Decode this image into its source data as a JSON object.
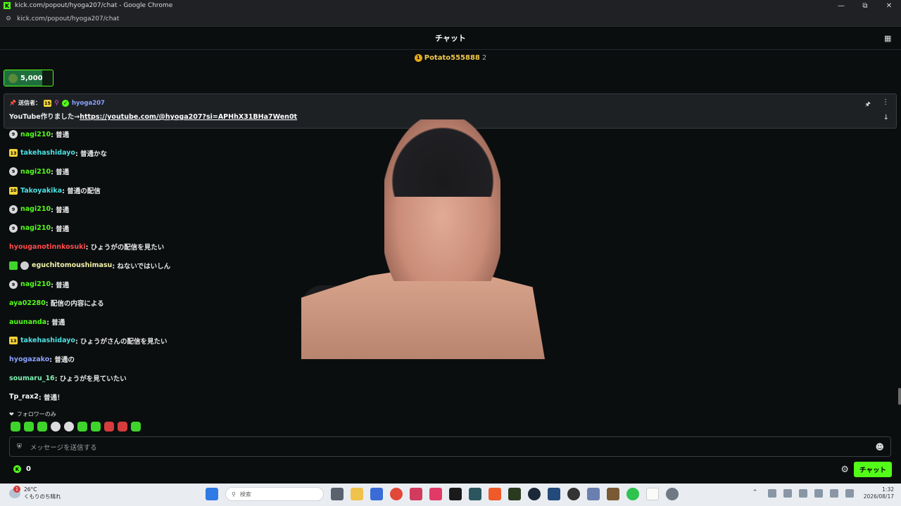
{
  "window": {
    "title": "kick.com/popout/hyoga207/chat - Google Chrome",
    "url": "kick.com/popout/hyoga207/chat",
    "logo_letter": "K"
  },
  "header": {
    "title": "チャット"
  },
  "leaderboard": {
    "rank": "1",
    "name": "Potato555888",
    "count": "2"
  },
  "points_widget": {
    "value": "5,000",
    "fill_fraction": 0.78
  },
  "pinned": {
    "sender_label": "送信者：",
    "sub_badge": "15",
    "username": "hyoga207",
    "message_prefix": "YouTube作りました→",
    "link": "https://youtube.com/@hyoga207?si=APHhX31BHa7Wen0t"
  },
  "messages": [
    {
      "badge": "9",
      "badge_type": "one",
      "user": "nagi210",
      "color": "#53fc18",
      "text": ": 普通"
    },
    {
      "badge": "13",
      "badge_type": "lvl",
      "user": "takehashidayo",
      "color": "#4ee0e0",
      "text": ": 普通かな"
    },
    {
      "badge": "9",
      "badge_type": "one",
      "user": "nagi210",
      "color": "#53fc18",
      "text": ": 普通"
    },
    {
      "badge": "10",
      "badge_type": "lvl",
      "user": "Takoyakika",
      "color": "#4ee0e0",
      "text": ": 普通の配信"
    },
    {
      "badge": "9",
      "badge_type": "one",
      "user": "nagi210",
      "color": "#53fc18",
      "text": ": 普通"
    },
    {
      "badge": "9",
      "badge_type": "one",
      "user": "nagi210",
      "color": "#53fc18",
      "text": ": 普通"
    },
    {
      "badge": "",
      "badge_type": "none",
      "user": "hyouganotinnkosuki",
      "color": "#ff4b4b",
      "text": ": ひょうがの配信を見たい"
    },
    {
      "badge": "",
      "badge_type": "emote",
      "user": "eguchitomoushimasu",
      "color": "#f2f2a8",
      "text": ": ねないではいしん"
    },
    {
      "badge": "9",
      "badge_type": "one",
      "user": "nagi210",
      "color": "#53fc18",
      "text": ": 普通"
    },
    {
      "badge": "",
      "badge_type": "none",
      "user": "aya02280",
      "color": "#53fc18",
      "text": ": 配信の内容による"
    },
    {
      "badge": "",
      "badge_type": "none",
      "user": "auunanda",
      "color": "#53fc18",
      "text": ": 普通"
    },
    {
      "badge": "13",
      "badge_type": "lvl",
      "user": "takehashidayo",
      "color": "#4ee0e0",
      "text": ": ひょうがさんの配信を見たい"
    },
    {
      "badge": "",
      "badge_type": "none",
      "user": "hyogazako",
      "color": "#8aa2ff",
      "text": ": 普通の"
    },
    {
      "badge": "",
      "badge_type": "none",
      "user": "soumaru_16",
      "color": "#7cf0b0",
      "text": ": ひょうがを見ていたい"
    },
    {
      "badge": "",
      "badge_type": "none",
      "user": "Tp_rax2",
      "color": "#ffffff",
      "text": ": 普通！"
    }
  ],
  "chat_mode": "フォロワーのみ",
  "input": {
    "placeholder": "メッセージを送信する"
  },
  "footer": {
    "points": "0",
    "send_label": "チャット"
  },
  "taskbar": {
    "weather_badge": "1",
    "temperature": "26°C",
    "weather_desc": "くもりのち晴れ",
    "search_placeholder": "検索",
    "time": "1:32",
    "date": "2026/08/17"
  }
}
